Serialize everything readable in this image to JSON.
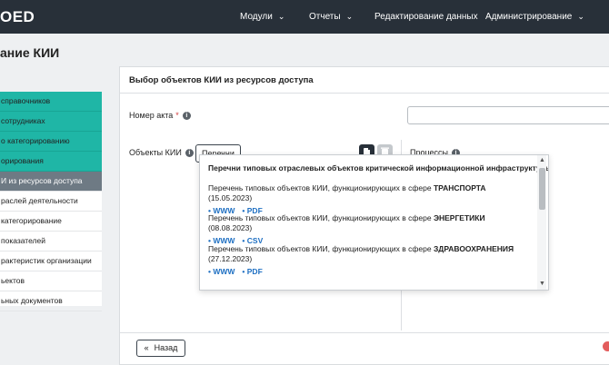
{
  "topbar": {
    "logo": "OED",
    "nav": [
      {
        "label": "Модули"
      },
      {
        "label": "Отчеты"
      },
      {
        "label": "Редактирование данных"
      },
      {
        "label": "Администрирование"
      }
    ]
  },
  "page_title": "ание КИИ",
  "sidebar": {
    "items": [
      {
        "label": "справочников",
        "style": "teal"
      },
      {
        "label": "сотрудниках",
        "style": "teal"
      },
      {
        "label": "о категорированию",
        "style": "teal"
      },
      {
        "label": "орирования",
        "style": "teal"
      },
      {
        "label": "И из ресурсов доступа",
        "style": "active"
      },
      {
        "label": "раслей деятельности",
        "style": "plain"
      },
      {
        "label": "категорирование",
        "style": "plain"
      },
      {
        "label": "показателей",
        "style": "plain"
      },
      {
        "label": "рактеристик организации",
        "style": "plain"
      },
      {
        "label": "ьектов",
        "style": "plain"
      },
      {
        "label": "ьных документов",
        "style": "plain"
      }
    ]
  },
  "main": {
    "card_title": "Выбор объектов КИИ из ресурсов доступа",
    "act_number_label": "Номер акта",
    "required_mark": "*",
    "objects_label": "Объекты КИИ",
    "perechni_button": "Перечни",
    "processes_label": "Процессы",
    "back_button": "Назад"
  },
  "dropdown": {
    "header": "Перечни типовых отраслевых объектов критической информационной инфраструктуры",
    "items": [
      {
        "prefix": "Перечень типовых объектов КИИ, функционирующих в сфере ",
        "sphere": "ТРАНСПОРТА",
        "date": " (15.05.2023)",
        "links": [
          "WWW",
          "PDF"
        ]
      },
      {
        "prefix": "Перечень типовых объектов КИИ, функционирующих в сфере ",
        "sphere": "ЭНЕРГЕТИКИ",
        "date": " (08.08.2023)",
        "links": [
          "WWW",
          "CSV"
        ]
      },
      {
        "prefix": "Перечень типовых объектов КИИ, функционирующих в сфере ",
        "sphere": "ЗДРАВООХРАНЕНИЯ",
        "date": " (27.12.2023)",
        "links": [
          "WWW",
          "PDF"
        ]
      }
    ]
  },
  "icons": [
    "chevron-down-icon",
    "info-icon",
    "add-icon",
    "delete-icon",
    "double-chevron-left-icon",
    "scroll-up-icon",
    "scroll-down-icon"
  ],
  "colors": {
    "topbar": "#283039",
    "teal": "#1fb6a6",
    "active": "#6e7a84",
    "link": "#1e6fc2",
    "required": "#d23c3c"
  }
}
